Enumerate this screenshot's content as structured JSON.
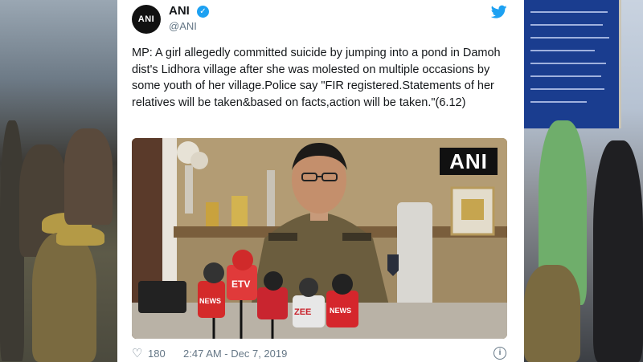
{
  "tweet": {
    "avatar_text": "ANI",
    "name": "ANI",
    "handle": "@ANI",
    "text": "MP: A girl allegedly committed suicide by jumping into a pond in Damoh dist's Lidhora village after she was molested on multiple occasions by some youth of her village.Police say \"FIR registered.Statements of her relatives will be taken&based on facts,action will be taken.\"(6.12)",
    "likes": "180",
    "timestamp": "2:47 AM - Dec 7, 2019"
  },
  "media": {
    "watermark": "ANI",
    "mic_labels": [
      "NEWS",
      "ETV",
      "ZEE",
      "NEWS"
    ]
  },
  "colors": {
    "twitter_blue": "#1da1f2",
    "text_primary": "#14171a",
    "text_secondary": "#657786"
  }
}
